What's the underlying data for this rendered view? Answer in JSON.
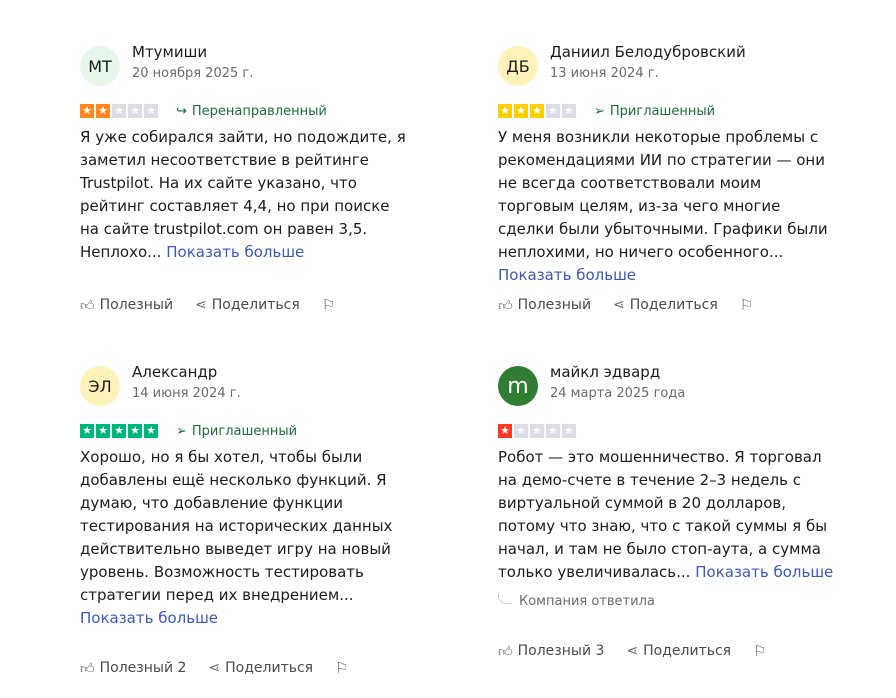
{
  "reviews": [
    {
      "avatar": "МТ",
      "avatar_bg": "#e7f6ea",
      "name": "Мтумиши",
      "date": "20 ноября 2025 г.",
      "rating": 2,
      "star_color": "#ff8622",
      "badge": "Перенаправленный",
      "badge_icon": "redirect-icon",
      "text": "Я уже собирался зайти, но подождите, я заметил несоответствие в рейтинге Trustpilot. На их сайте указано, что рейтинг составляет 4,4, но при поиске на сайте trustpilot.com он равен 3,5. Неплохо...",
      "more": "Показать больше",
      "useful": "Полезный",
      "share": "Поделиться"
    },
    {
      "avatar": "ДБ",
      "avatar_bg": "#fff2b8",
      "name": "Даниил Белодубровский",
      "date": "13 июня 2024 г.",
      "rating": 3,
      "star_color": "#ffce00",
      "badge": "Приглашенный",
      "badge_icon": "invited-icon",
      "text": "У меня возникли некоторые проблемы с рекомендациями ИИ по стратегии — они не всегда соответствовали моим торговым целям, из-за чего многие сделки были убыточными. Графики были неплохими, но ничего особенного...",
      "more": "Показать больше",
      "useful": "Полезный",
      "share": "Поделиться"
    },
    {
      "avatar": "ЭЛ",
      "avatar_bg": "#fff2b8",
      "name": "Александр",
      "date": "14 июня 2024 г.",
      "rating": 5,
      "star_color": "#00b67a",
      "badge": "Приглашенный",
      "badge_icon": "invited-icon",
      "text": "Хорошо, но я бы хотел, чтобы были добавлены ещё несколько функций. Я думаю, что добавление функции тестирования на исторических данных действительно выведет игру на новый уровень. Возможность тестировать стратегии перед их внедрением...",
      "more": "Показать больше",
      "useful": "Полезный 2",
      "share": "Поделиться"
    },
    {
      "avatar": "m",
      "avatar_bg": "#2e7d32",
      "name": "майкл эдвард",
      "date": "24 марта 2025 года",
      "rating": 1,
      "star_color": "#ff3722",
      "badge": "",
      "text": "Робот — это мошенничество. Я торговал на демо-счете в течение 2–3 недель с виртуальной суммой в 20 долларов, потому что знаю, что с такой суммы я бы начал, и там не было стоп-аута, а сумма только увеличивалась...",
      "more": "Показать больше",
      "reply": "Компания ответила",
      "useful": "Полезный 3",
      "share": "Поделиться"
    }
  ]
}
